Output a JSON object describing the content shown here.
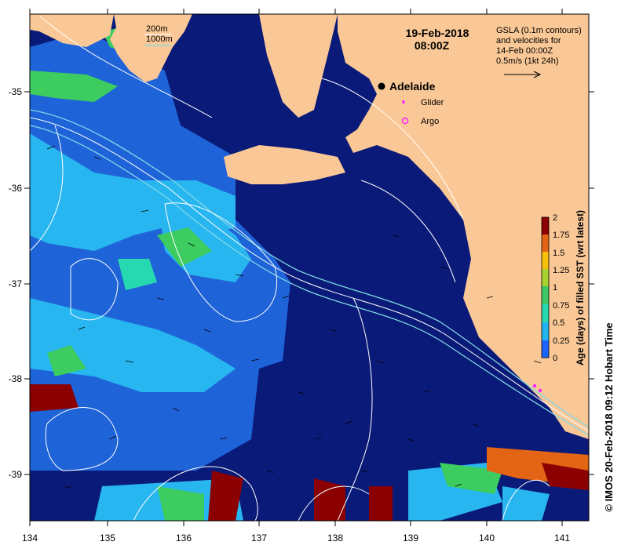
{
  "header": {
    "date": "19-Feb-2018",
    "time": "08:00Z"
  },
  "contour_legend": {
    "items": [
      {
        "label": "200m",
        "color": "#ffffff"
      },
      {
        "label": "1000m",
        "color": "#7fd8e6"
      }
    ]
  },
  "gsla_legend": {
    "lines": [
      "GSLA (0.1m contours)",
      "and velocities for",
      "14-Feb 00:00Z",
      "0.5m/s (1kt 24h)"
    ]
  },
  "places": {
    "city": "Adelaide",
    "glider_label": "Glider",
    "argo_label": "Argo"
  },
  "colorbar": {
    "title": "Age (days) of filled SST (wrt latest)",
    "ticks": [
      "2",
      "1.75",
      "1.5",
      "1.25",
      "1",
      "0.75",
      "0.5",
      "0.25",
      "0"
    ],
    "colors": [
      "#0000c8",
      "#1e64ff",
      "#22b4ee",
      "#26d9b0",
      "#3cc864",
      "#a8d232",
      "#f5c00a",
      "#e36414",
      "#8b0000"
    ]
  },
  "credit": "© IMOS 20-Feb-2018 09:12 Hobart Time",
  "axes": {
    "x_ticks": [
      "134",
      "135",
      "136",
      "137",
      "138",
      "139",
      "140",
      "141"
    ],
    "y_ticks": [
      "-35",
      "-36",
      "-37",
      "-38",
      "-39"
    ]
  },
  "colors": {
    "land": "#fac896",
    "deep_blue": "#0a1a7a",
    "mid_blue": "#2a4fd0",
    "light_blue": "#28b6f0"
  }
}
